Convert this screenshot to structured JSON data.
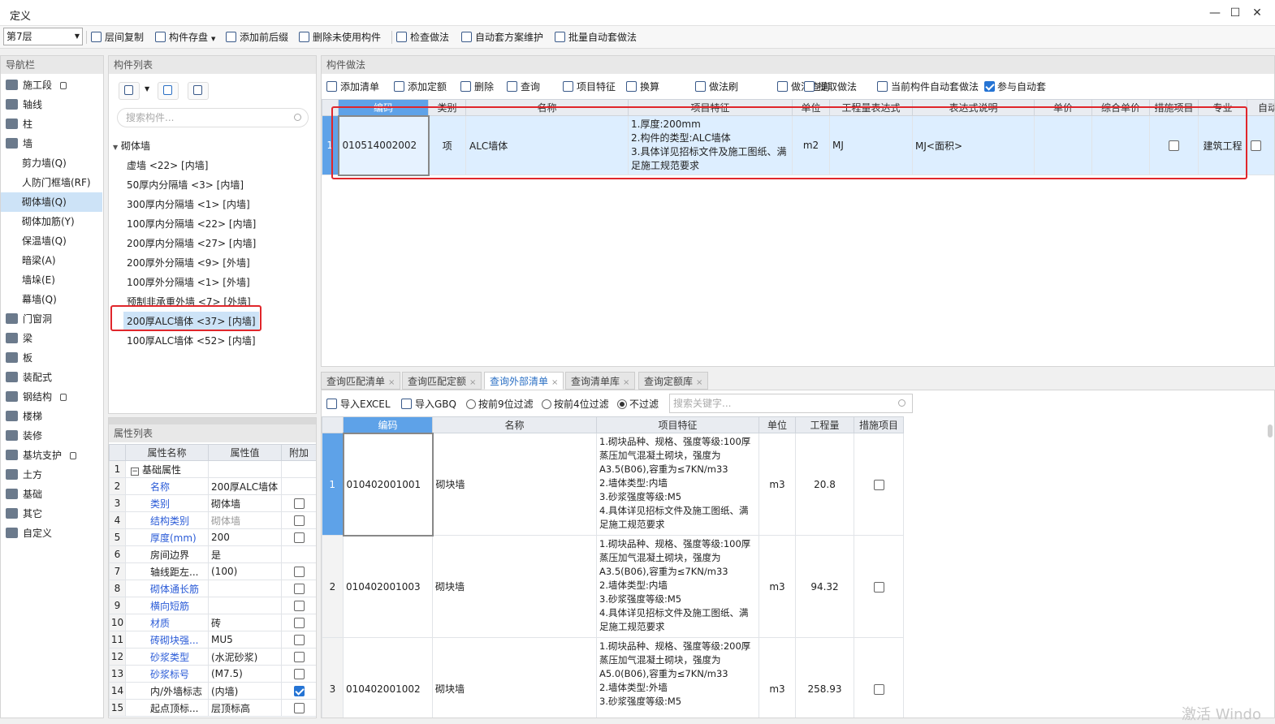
{
  "window": {
    "title": "定义"
  },
  "toolbar": {
    "floor": "第7层",
    "items": [
      "层间复制",
      "构件存盘",
      "添加前后缀",
      "删除未使用构件",
      "检查做法",
      "自动套方案维护",
      "批量自动套做法"
    ]
  },
  "nav": {
    "title": "导航栏",
    "items": [
      {
        "label": "施工段",
        "sub": false,
        "lock": true
      },
      {
        "label": "轴线",
        "sub": false
      },
      {
        "label": "柱",
        "sub": false
      },
      {
        "label": "墙",
        "sub": false
      },
      {
        "label": "剪力墙(Q)",
        "sub": true
      },
      {
        "label": "人防门框墙(RF)",
        "sub": true
      },
      {
        "label": "砌体墙(Q)",
        "sub": true,
        "selected": true
      },
      {
        "label": "砌体加筋(Y)",
        "sub": true
      },
      {
        "label": "保温墙(Q)",
        "sub": true
      },
      {
        "label": "暗梁(A)",
        "sub": true
      },
      {
        "label": "墙垛(E)",
        "sub": true
      },
      {
        "label": "幕墙(Q)",
        "sub": true
      },
      {
        "label": "门窗洞",
        "sub": false
      },
      {
        "label": "梁",
        "sub": false
      },
      {
        "label": "板",
        "sub": false
      },
      {
        "label": "装配式",
        "sub": false
      },
      {
        "label": "钢结构",
        "sub": false,
        "lock": true
      },
      {
        "label": "楼梯",
        "sub": false
      },
      {
        "label": "装修",
        "sub": false
      },
      {
        "label": "基坑支护",
        "sub": false,
        "lock": true
      },
      {
        "label": "土方",
        "sub": false
      },
      {
        "label": "基础",
        "sub": false
      },
      {
        "label": "其它",
        "sub": false
      },
      {
        "label": "自定义",
        "sub": false
      }
    ]
  },
  "components": {
    "title": "构件列表",
    "search_placeholder": "搜索构件...",
    "group": "砌体墙",
    "items": [
      "虚墙 <22> [内墙]",
      "50厚内分隔墙 <3> [内墙]",
      "300厚内分隔墙 <1> [内墙]",
      "100厚内分隔墙 <22> [内墙]",
      "200厚内分隔墙 <27> [内墙]",
      "200厚外分隔墙 <9> [外墙]",
      "100厚外分隔墙 <1> [外墙]",
      "预制非承重外墙 <7> [外墙]",
      "200厚ALC墙体 <37> [内墙]",
      "100厚ALC墙体 <52> [内墙]"
    ],
    "selected_index": 8
  },
  "props": {
    "title": "属性列表",
    "headers": [
      "属性名称",
      "属性值",
      "附加"
    ],
    "rows": [
      {
        "n": "1",
        "name": "基础属性",
        "value": "",
        "blue": false,
        "chk": null,
        "group": true
      },
      {
        "n": "2",
        "name": "名称",
        "value": "200厚ALC墙体",
        "blue": true,
        "chk": null
      },
      {
        "n": "3",
        "name": "类别",
        "value": "砌体墙",
        "blue": true,
        "chk": false
      },
      {
        "n": "4",
        "name": "结构类别",
        "value": "砌体墙",
        "blue": true,
        "chk": false,
        "gray": true
      },
      {
        "n": "5",
        "name": "厚度(mm)",
        "value": "200",
        "blue": true,
        "chk": false
      },
      {
        "n": "6",
        "name": "房间边界",
        "value": "是",
        "blue": false,
        "chk": null
      },
      {
        "n": "7",
        "name": "轴线距左...",
        "value": "(100)",
        "blue": false,
        "chk": false
      },
      {
        "n": "8",
        "name": "砌体通长筋",
        "value": "",
        "blue": true,
        "chk": false
      },
      {
        "n": "9",
        "name": "横向短筋",
        "value": "",
        "blue": true,
        "chk": false
      },
      {
        "n": "10",
        "name": "材质",
        "value": "砖",
        "blue": true,
        "chk": false
      },
      {
        "n": "11",
        "name": "砖砌块强...",
        "value": "MU5",
        "blue": true,
        "chk": false
      },
      {
        "n": "12",
        "name": "砂浆类型",
        "value": "(水泥砂浆)",
        "blue": true,
        "chk": false
      },
      {
        "n": "13",
        "name": "砂浆标号",
        "value": "(M7.5)",
        "blue": true,
        "chk": false
      },
      {
        "n": "14",
        "name": "内/外墙标志",
        "value": "(内墙)",
        "blue": false,
        "chk": true
      },
      {
        "n": "15",
        "name": "起点顶标...",
        "value": "层顶标高",
        "blue": false,
        "chk": false
      }
    ]
  },
  "method": {
    "title": "构件做法",
    "tools": [
      "添加清单",
      "添加定额",
      "删除",
      "查询",
      "项目特征",
      "换算",
      "做法刷",
      "做法查询",
      "提取做法",
      "当前构件自动套做法",
      "参与自动套"
    ],
    "headers": [
      "编码",
      "类别",
      "名称",
      "项目特征",
      "单位",
      "工程量表达式",
      "表达式说明",
      "单价",
      "综合单价",
      "措施项目",
      "专业",
      "自动"
    ],
    "row": {
      "n": "1",
      "code": "010514002002",
      "type": "项",
      "name": "ALC墙体",
      "feature": [
        "1.厚度:200mm",
        "2.构件的类型:ALC墙体",
        "3.具体详见招标文件及施工图纸、满足施工规范要求"
      ],
      "unit": "m2",
      "expr": "MJ",
      "desc": "MJ<面积>",
      "price": "",
      "cprice": "",
      "measure": false,
      "major": "建筑工程"
    }
  },
  "bottom": {
    "tabs": [
      "查询匹配清单",
      "查询匹配定额",
      "查询外部清单",
      "查询清单库",
      "查询定额库"
    ],
    "active": 2,
    "tools": {
      "excel": "导入EXCEL",
      "gbq": "导入GBQ",
      "r1": "按前9位过滤",
      "r2": "按前4位过滤",
      "r3": "不过滤",
      "search_placeholder": "搜索关键字..."
    },
    "headers": [
      "编码",
      "名称",
      "项目特征",
      "单位",
      "工程量",
      "措施项目"
    ],
    "rows": [
      {
        "n": "1",
        "code": "010402001001",
        "name": "砌块墙",
        "feature": [
          "1.砌块品种、规格、强度等级:100厚",
          "蒸压加气混凝土砌块，强度为",
          "A3.5(B06),容重为≤7KN/m33",
          "2.墙体类型:内墙",
          "3.砂浆强度等级:M5",
          "4.具体详见招标文件及施工图纸、满",
          "足施工规范要求"
        ],
        "unit": "m3",
        "qty": "20.8"
      },
      {
        "n": "2",
        "code": "010402001003",
        "name": "砌块墙",
        "feature": [
          "1.砌块品种、规格、强度等级:100厚",
          "蒸压加气混凝土砌块，强度为",
          "A3.5(B06),容重为≤7KN/m33",
          "2.墙体类型:内墙",
          "3.砂浆强度等级:M5",
          "4.具体详见招标文件及施工图纸、满",
          "足施工规范要求"
        ],
        "unit": "m3",
        "qty": "94.32"
      },
      {
        "n": "3",
        "code": "010402001002",
        "name": "砌块墙",
        "feature": [
          "1.砌块品种、规格、强度等级:200厚",
          "蒸压加气混凝土砌块，强度为",
          "A5.0(B06),容重为≤7KN/m33",
          "2.墙体类型:外墙",
          "3.砂浆强度等级:M5"
        ],
        "unit": "m3",
        "qty": "258.93"
      }
    ]
  },
  "watermark": "激活 Windo"
}
